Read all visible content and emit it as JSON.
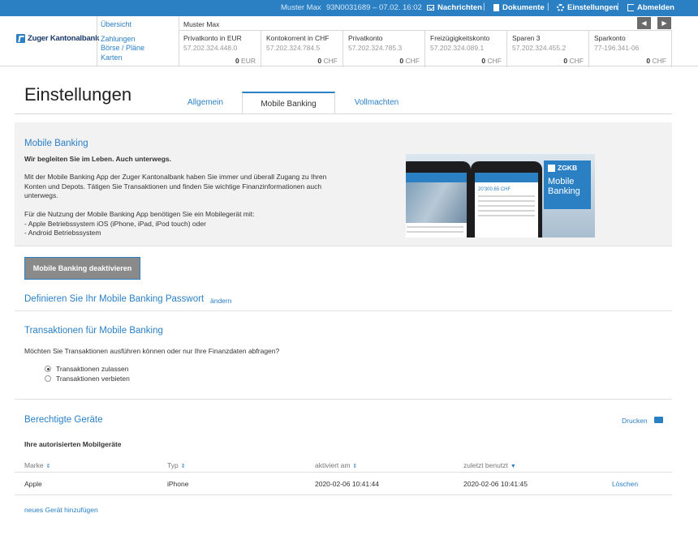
{
  "topbar": {
    "user": "Muster Max",
    "contract": "93N0031689 – 07.02. 16:02",
    "messages": "Nachrichten",
    "documents": "Dokumente",
    "settings": "Einstellungen",
    "logout": "Abmelden"
  },
  "bank": {
    "name": "Zuger Kantonalbank"
  },
  "nav": {
    "overview": "Übersicht",
    "payments": "Zahlungen",
    "exchange": "Börse / Pläne",
    "cards": "Karten"
  },
  "owner": "Muster Max",
  "accounts": [
    {
      "name": "Privatkonto in EUR",
      "iban": "57.202.324.448.0",
      "balance": "0",
      "currency": "EUR"
    },
    {
      "name": "Kontokorrent in CHF",
      "iban": "57.202.324.784.5",
      "balance": "0",
      "currency": "CHF"
    },
    {
      "name": "Privatkonto",
      "iban": "57.202.324.785.3",
      "balance": "0",
      "currency": "CHF"
    },
    {
      "name": "Freizügigkeitskonto",
      "iban": "57.202.324.089.1",
      "balance": "0",
      "currency": "CHF"
    },
    {
      "name": "Sparen 3",
      "iban": "57.202.324.455.2",
      "balance": "0",
      "currency": "CHF"
    },
    {
      "name": "Sparkonto",
      "iban": "77-196.341-06",
      "balance": "0",
      "currency": "CHF"
    }
  ],
  "page": {
    "title": "Einstellungen",
    "tabs": [
      "Allgemein",
      "Mobile Banking",
      "Vollmachten"
    ]
  },
  "mobile": {
    "heading": "Mobile Banking",
    "tagline": "Wir begleiten Sie im Leben. Auch unterwegs.",
    "intro_1": "Mit der Mobile Banking App der Zuger Kantonalbank haben Sie immer und überall Zugang zu Ihren",
    "intro_2": "Konten und Depots. Tätigen Sie Transaktionen und finden Sie wichtige Finanzinformationen auch",
    "intro_3": "unterwegs.",
    "req_intro": "Für die Nutzung der Mobile Banking App benötigen Sie ein Mobilegerät mit:",
    "req_ios": "- Apple Betriebssystem iOS (iPhone, iPad, iPod touch) oder",
    "req_android": "- Android Betriebssystem",
    "brand_short": "ZGKB",
    "brand_app": "Mobile Banking",
    "deactivate": "Mobile Banking deaktivieren"
  },
  "password": {
    "heading": "Definieren Sie Ihr Mobile Banking Passwort",
    "change": "ändern"
  },
  "transactions": {
    "heading": "Transaktionen für Mobile Banking",
    "question": "Möchten Sie Transaktionen ausführen können oder nur Ihre Finanzdaten abfragen?",
    "allow": "Transaktionen zulassen",
    "forbid": "Transaktionen verbieten",
    "selected": "allow"
  },
  "devices": {
    "heading": "Berechtigte Geräte",
    "print": "Drucken",
    "subheading": "Ihre autorisierten Mobilgeräte",
    "columns": [
      "Marke",
      "Typ",
      "aktiviert am",
      "zuletzt benutzt"
    ],
    "rows": [
      {
        "brand": "Apple",
        "type": "iPhone",
        "activated": "2020-02-06 10:41:44",
        "last_used": "2020-02-06 10:41:45",
        "action": "Löschen"
      }
    ],
    "add": "neues Gerät hinzufügen"
  }
}
